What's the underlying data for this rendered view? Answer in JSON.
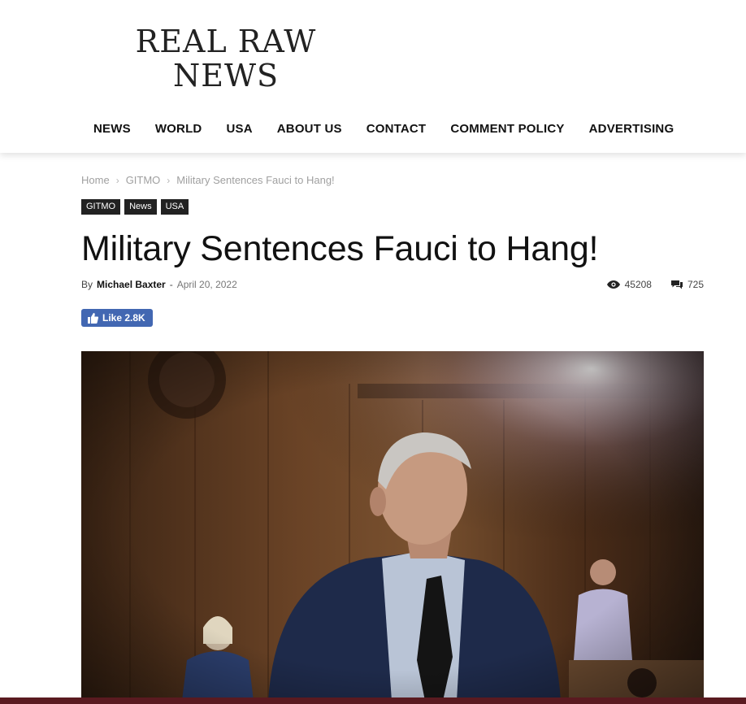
{
  "logo": {
    "line1": "REAL RAW",
    "line2": "NEWS"
  },
  "nav": [
    "NEWS",
    "WORLD",
    "USA",
    "ABOUT US",
    "CONTACT",
    "COMMENT POLICY",
    "ADVERTISING"
  ],
  "breadcrumb": {
    "home": "Home",
    "category": "GITMO",
    "current": "Military Sentences Fauci to Hang!",
    "separator": "›"
  },
  "tags": [
    "GITMO",
    "News",
    "USA"
  ],
  "article": {
    "title": "Military Sentences Fauci to Hang!",
    "by": "By",
    "author": "Michael Baxter",
    "dash": "-",
    "date": "April 20, 2022",
    "views": "45208",
    "comments": "725"
  },
  "like_button": {
    "label": "Like 2.8K"
  },
  "colors": {
    "like_blue": "#4267b2",
    "tag_bg": "#222222",
    "breadcrumb_gray": "#a0a0a0"
  },
  "icons": {
    "views": "eye-icon",
    "comments": "comment-icon",
    "like": "thumbs-up-icon"
  }
}
